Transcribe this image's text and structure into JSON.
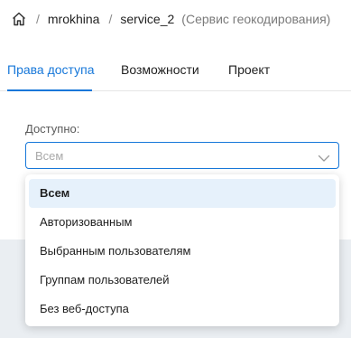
{
  "breadcrumb": {
    "home_icon": "home-icon",
    "separator": "/",
    "user": "mrokhina",
    "service": "service_2",
    "service_description": "(Сервис геокодирования)"
  },
  "tabs": [
    {
      "label": "Права доступа",
      "active": true
    },
    {
      "label": "Возможности",
      "active": false
    },
    {
      "label": "Проект",
      "active": false
    }
  ],
  "access": {
    "label": "Доступно:",
    "placeholder": "Всем",
    "expanded": true,
    "selected": "Всем",
    "options": [
      {
        "label": "Всем",
        "selected": true
      },
      {
        "label": "Авторизованным",
        "selected": false
      },
      {
        "label": "Выбранным пользователям",
        "selected": false
      },
      {
        "label": "Группам пользователей",
        "selected": false
      },
      {
        "label": "Без веб-доступа",
        "selected": false
      }
    ]
  },
  "colors": {
    "accent": "#1677d9",
    "selected_option_bg": "#e6f1fb",
    "placeholder_text": "#a9a9a9",
    "page_shade": "#eaeef2"
  }
}
